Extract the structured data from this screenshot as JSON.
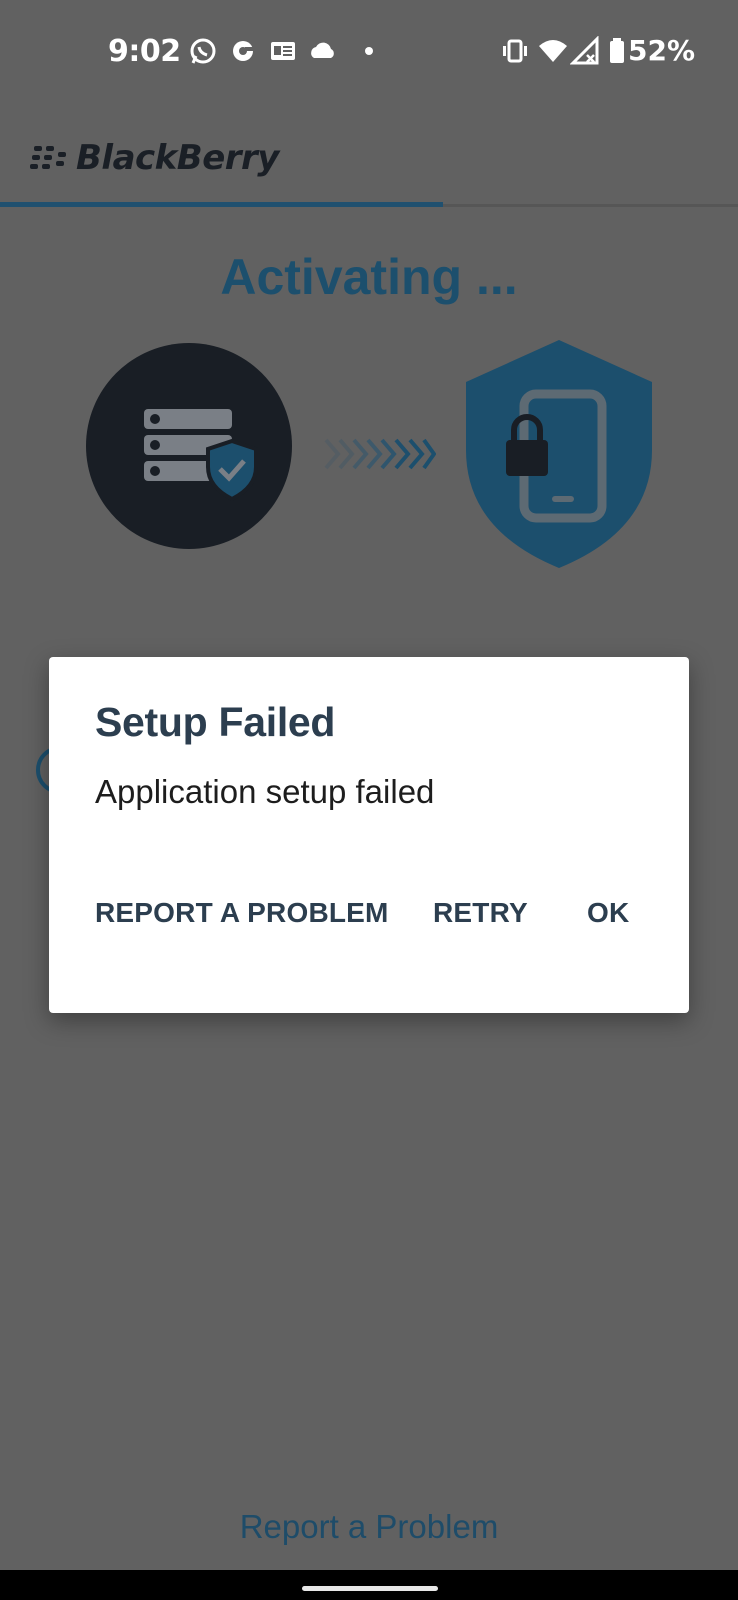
{
  "status_bar": {
    "time": "9:02",
    "battery_percent": "52%",
    "icons": [
      "whatsapp-icon",
      "sync-icon",
      "news-icon",
      "cloud-icon",
      "dot-icon",
      "vibrate-icon",
      "wifi-icon",
      "signal-icon",
      "battery-icon"
    ]
  },
  "header": {
    "logo_text": "BlackBerry",
    "progress_color": "#20506f"
  },
  "main": {
    "title": "Activating ...",
    "report_link": "Report a Problem",
    "illustration_icons": [
      "server-shield-icon",
      "arrows-icon",
      "phone-lock-shield-icon"
    ]
  },
  "dialog": {
    "title": "Setup Failed",
    "message": "Application setup failed",
    "buttons": {
      "report": "REPORT A PROBLEM",
      "retry": "RETRY",
      "ok": "OK"
    }
  },
  "colors": {
    "accent": "#1c4f6d",
    "dialog_bg": "#ffffff",
    "overlay_bg": "#616161"
  }
}
